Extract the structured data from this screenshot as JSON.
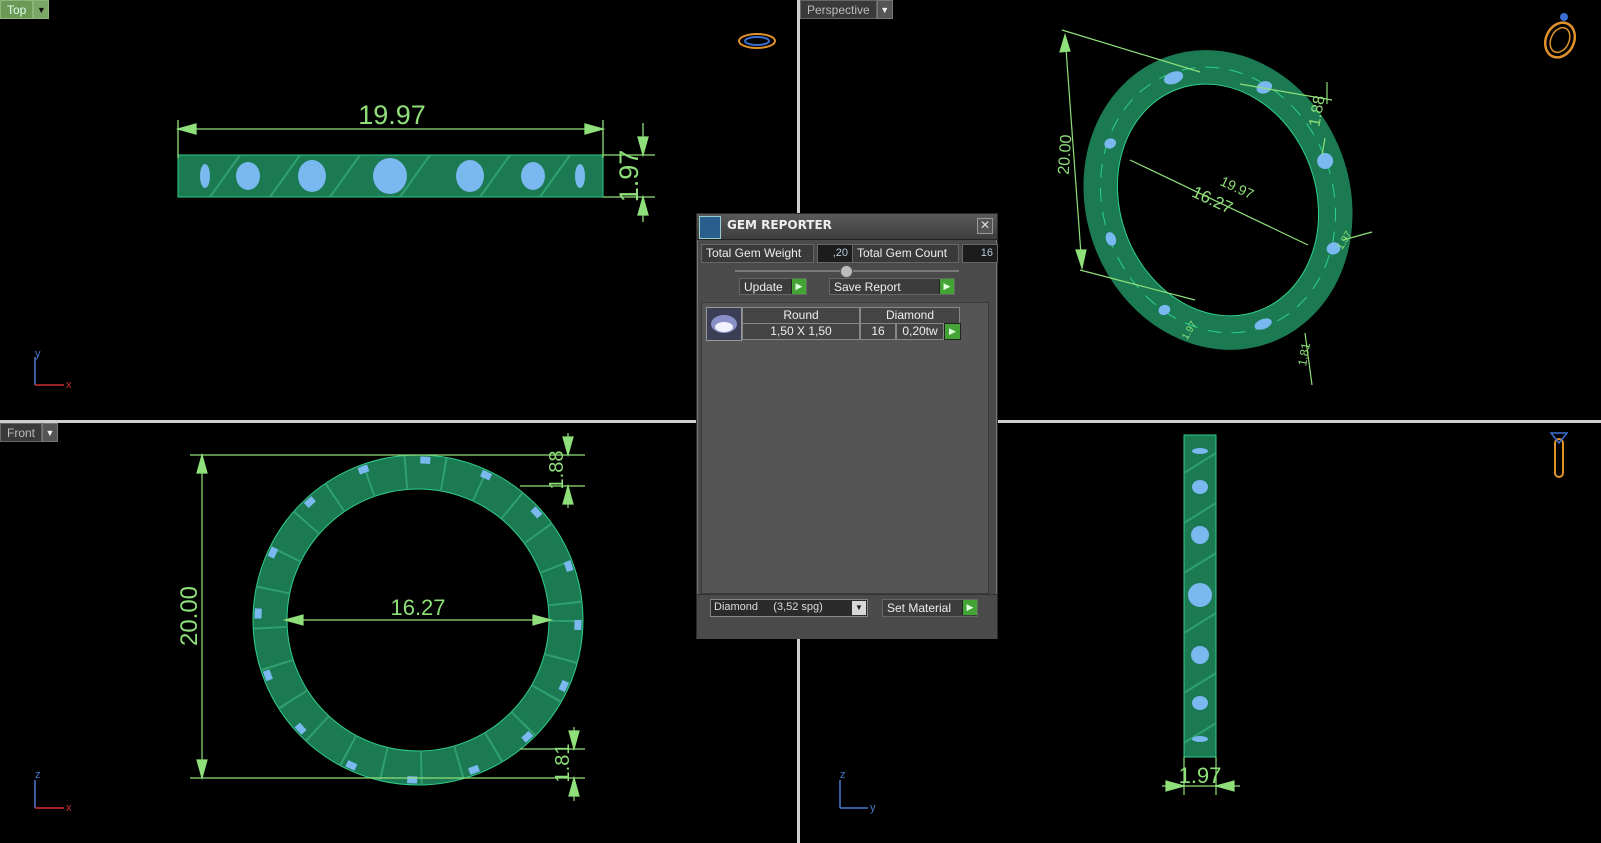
{
  "viewports": {
    "top": {
      "label": "Top",
      "dim_length": "19.97",
      "dim_height": "1.97",
      "axis_a": "y",
      "axis_b": "x"
    },
    "perspective": {
      "label": "Perspective",
      "dim_20": "20.00",
      "dim_1997": "19.97",
      "dim_1627": "16.27",
      "dim_188": "1.88",
      "dim_181": "1.81",
      "dim_197": "1.97",
      "dim_197b": "1.97"
    },
    "front": {
      "label": "Front",
      "dim_outer": "20.00",
      "dim_inner": "16.27",
      "dim_top": "1.88",
      "dim_bottom": "1.81",
      "axis_a": "z",
      "axis_b": "x"
    },
    "right": {
      "dim_width": "1.97",
      "axis_a": "z",
      "axis_b": "y"
    }
  },
  "gem_reporter": {
    "title": "GEM REPORTER",
    "close": "✕",
    "total_weight_label": "Total Gem Weight",
    "total_weight_value": ",20",
    "total_count_label": "Total Gem Count",
    "total_count_value": "16",
    "update_label": "Update",
    "save_report_label": "Save Report",
    "table_header": {
      "cut": "Round",
      "material": "Diamond"
    },
    "gems": [
      {
        "size": "1,50 X 1,50",
        "count": "16",
        "weight": "0,20tw"
      }
    ],
    "material_select": "Diamond     (3,52 spg)",
    "set_material_label": "Set Material"
  },
  "colors": {
    "dimension": "#8fe07a",
    "ring": "#1d8a5a",
    "gem": "#7ab8f0",
    "nav_icon": "#e0922a"
  },
  "icons": [
    "dropdown-arrow-icon",
    "play-arrow-icon",
    "close-icon",
    "nav-cube-icon",
    "axis-icon",
    "gem-thumbnail-icon"
  ]
}
